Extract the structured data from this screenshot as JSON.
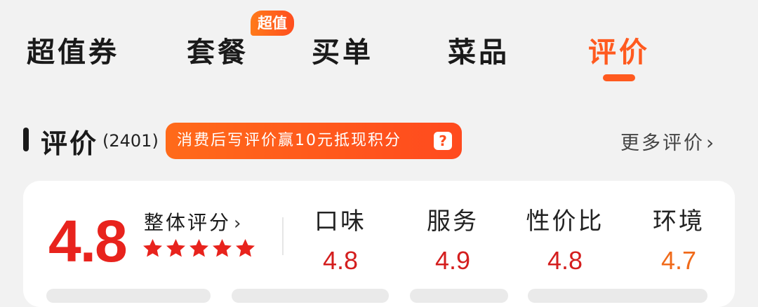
{
  "tabs": [
    {
      "label": "超值券"
    },
    {
      "label": "套餐"
    },
    {
      "label": "买单"
    },
    {
      "label": "菜品"
    },
    {
      "label": "评价"
    }
  ],
  "active_tab": "评价",
  "badge": {
    "label": "超值"
  },
  "section": {
    "title": "评价",
    "count": "(2401)",
    "promo": "消费后写评价赢10元抵现积分",
    "help_glyph": "?",
    "more_label": "更多评价",
    "more_chevron": "›"
  },
  "rating": {
    "score": "4.8",
    "label": "整体评分",
    "label_chevron": "›",
    "stars": 5,
    "sub_scores": [
      {
        "label": "口味",
        "value": "4.8"
      },
      {
        "label": "服务",
        "value": "4.9"
      },
      {
        "label": "性价比",
        "value": "4.8"
      },
      {
        "label": "环境",
        "value": "4.7"
      }
    ]
  },
  "colors": {
    "accent": "#ff5a1f",
    "score_red": "#e8231d",
    "score_orange": "#f06a1a",
    "star": "#e8231d"
  }
}
